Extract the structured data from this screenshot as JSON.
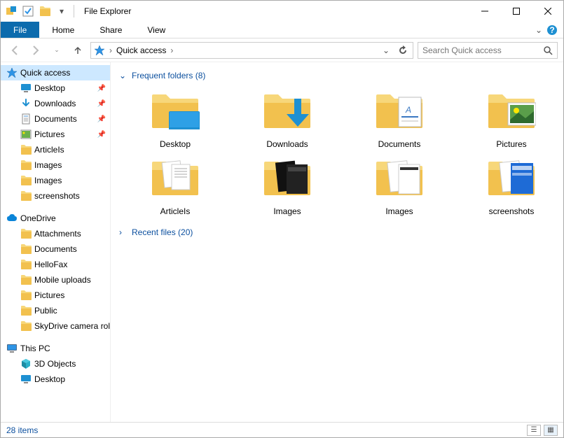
{
  "window": {
    "title": "File Explorer"
  },
  "ribbon": {
    "file": "File",
    "tabs": [
      "Home",
      "Share",
      "View"
    ]
  },
  "nav": {
    "crumb1": "Quick access",
    "search_placeholder": "Search Quick access"
  },
  "sidebar": {
    "quick_access": "Quick access",
    "qa_items": [
      {
        "label": "Desktop",
        "pinned": true,
        "icon": "desktop"
      },
      {
        "label": "Downloads",
        "pinned": true,
        "icon": "downloads"
      },
      {
        "label": "Documents",
        "pinned": true,
        "icon": "documents"
      },
      {
        "label": "Pictures",
        "pinned": true,
        "icon": "pictures"
      },
      {
        "label": "ArticleIs",
        "pinned": false,
        "icon": "folder"
      },
      {
        "label": "Images",
        "pinned": false,
        "icon": "folder"
      },
      {
        "label": "Images",
        "pinned": false,
        "icon": "folder"
      },
      {
        "label": "screenshots",
        "pinned": false,
        "icon": "folder"
      }
    ],
    "onedrive": "OneDrive",
    "od_items": [
      {
        "label": "Attachments"
      },
      {
        "label": "Documents"
      },
      {
        "label": "HelloFax"
      },
      {
        "label": "Mobile uploads"
      },
      {
        "label": "Pictures"
      },
      {
        "label": "Public"
      },
      {
        "label": "SkyDrive camera roll"
      }
    ],
    "thispc": "This PC",
    "pc_items": [
      {
        "label": "3D Objects",
        "icon": "3d"
      },
      {
        "label": "Desktop",
        "icon": "desktop"
      }
    ]
  },
  "content": {
    "frequent_header": "Frequent folders (8)",
    "recent_header": "Recent files (20)",
    "frequent": [
      {
        "label": "Desktop",
        "kind": "desktop"
      },
      {
        "label": "Downloads",
        "kind": "downloads"
      },
      {
        "label": "Documents",
        "kind": "documents"
      },
      {
        "label": "Pictures",
        "kind": "pictures"
      },
      {
        "label": "ArticleIs",
        "kind": "documents-preview"
      },
      {
        "label": "Images",
        "kind": "images-dark"
      },
      {
        "label": "Images",
        "kind": "images-light"
      },
      {
        "label": "screenshots",
        "kind": "screenshots"
      }
    ]
  },
  "status": {
    "text": "28 items"
  }
}
